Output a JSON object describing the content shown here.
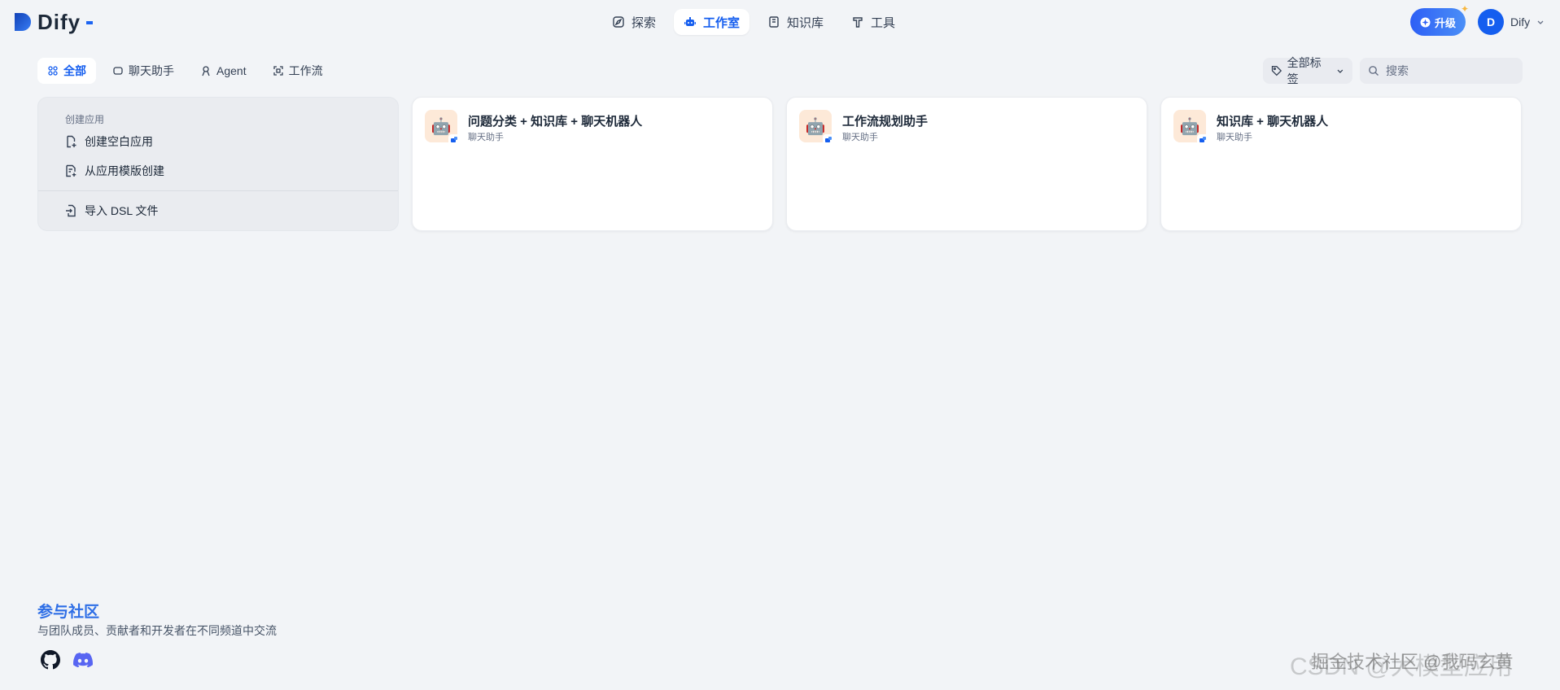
{
  "brand": {
    "name": "Dify"
  },
  "nav": {
    "items": [
      {
        "label": "探索",
        "icon": "compass-icon"
      },
      {
        "label": "工作室",
        "icon": "robot-icon",
        "active": true
      },
      {
        "label": "知识库",
        "icon": "book-icon"
      },
      {
        "label": "工具",
        "icon": "tool-icon"
      }
    ]
  },
  "header": {
    "upgrade_label": "升级",
    "user_initial": "D",
    "user_name": "Dify"
  },
  "filters": {
    "tabs": [
      {
        "label": "全部",
        "active": true
      },
      {
        "label": "聊天助手"
      },
      {
        "label": "Agent"
      },
      {
        "label": "工作流"
      }
    ],
    "tag_label": "全部标签",
    "search_placeholder": "搜索"
  },
  "create": {
    "title": "创建应用",
    "blank_label": "创建空白应用",
    "template_label": "从应用模版创建",
    "import_label": "导入 DSL 文件"
  },
  "apps": [
    {
      "name": "问题分类 + 知识库 + 聊天机器人",
      "type": "聊天助手"
    },
    {
      "name": "工作流规划助手",
      "type": "聊天助手"
    },
    {
      "name": "知识库 + 聊天机器人",
      "type": "聊天助手"
    }
  ],
  "footer": {
    "title": "参与社区",
    "description": "与团队成员、贡献者和开发者在不同频道中交流"
  },
  "watermark": {
    "line1": "CSDN @大模型应用",
    "line2": "掘金技术社区 @我码玄黄"
  },
  "colors": {
    "accent": "#155eef",
    "background": "#f2f4f7"
  }
}
